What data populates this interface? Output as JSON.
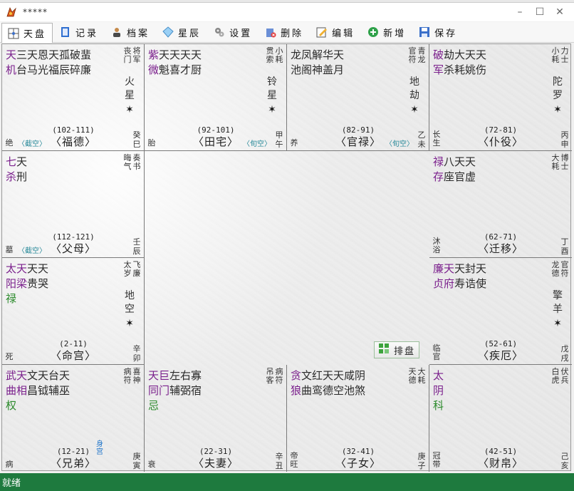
{
  "window": {
    "title": "*****"
  },
  "toolbar": [
    {
      "label": "天盘",
      "icon": "grid-icon"
    },
    {
      "label": "记录",
      "icon": "notebook-icon"
    },
    {
      "label": "档案",
      "icon": "person-icon"
    },
    {
      "label": "星辰",
      "icon": "diamond-icon"
    },
    {
      "label": "设置",
      "icon": "gears-icon"
    },
    {
      "label": "删除",
      "icon": "delete-icon"
    },
    {
      "label": "编辑",
      "icon": "edit-icon"
    },
    {
      "label": "新增",
      "icon": "plus-icon"
    },
    {
      "label": "保存",
      "icon": "save-icon"
    }
  ],
  "palaces": [
    {
      "name": "福德",
      "ages": "(102-111)",
      "stage": "绝",
      "ganzhi": "癸巳",
      "row1": [
        [
          "天",
          "purple"
        ],
        [
          "三天恩天孤破蜚",
          "dark"
        ]
      ],
      "row2": [
        [
          "机",
          "purple"
        ],
        [
          "台马光福辰碎廉",
          "dark"
        ]
      ],
      "row3": [],
      "corner": [
        "将军",
        "丧门"
      ],
      "vstar": "火星",
      "kong": "〈截空〉"
    },
    {
      "name": "田宅",
      "ages": "(92-101)",
      "stage": "胎",
      "ganzhi": "甲午",
      "row1": [
        [
          "紫",
          "purple"
        ],
        [
          "天天天天",
          "dark"
        ]
      ],
      "row2": [
        [
          "微",
          "purple"
        ],
        [
          "魁喜才厨",
          "dark"
        ]
      ],
      "row3": [],
      "corner": [
        "小耗",
        "贯索"
      ],
      "vstar": "铃星",
      "kong": "〈旬空〉"
    },
    {
      "name": "官禄",
      "ages": "(82-91)",
      "stage": "养",
      "ganzhi": "乙未",
      "row1": [
        [
          "龙凤解华天",
          "dark"
        ]
      ],
      "row2": [
        [
          "池阁神盖月",
          "dark"
        ]
      ],
      "row3": [],
      "corner": [
        "青龙",
        "官符"
      ],
      "vstar": "地劫",
      "kong": "〈旬空〉"
    },
    {
      "name": "仆役",
      "ages": "(72-81)",
      "stage": "长生",
      "ganzhi": "丙申",
      "row1": [
        [
          "破",
          "purple"
        ],
        [
          "劫大天天",
          "dark"
        ]
      ],
      "row2": [
        [
          "军",
          "purple"
        ],
        [
          "杀耗姚伤",
          "dark"
        ]
      ],
      "row3": [],
      "corner": [
        "力士",
        "小耗"
      ],
      "vstar": "陀罗",
      "kong": ""
    },
    {
      "name": "父母",
      "ages": "(112-121)",
      "stage": "墓",
      "ganzhi": "壬辰",
      "row1": [
        [
          "七",
          "purple"
        ],
        [
          "天",
          "dark"
        ]
      ],
      "row2": [
        [
          "杀",
          "purple"
        ],
        [
          "刑",
          "dark"
        ]
      ],
      "row3": [],
      "corner": [
        "奏书",
        "晦气"
      ],
      "vstar": "",
      "kong": "〈截空〉"
    },
    {
      "name": "迁移",
      "ages": "(62-71)",
      "stage": "沐浴",
      "ganzhi": "丁酉",
      "row1": [
        [
          "禄",
          "purple"
        ],
        [
          "八天天",
          "dark"
        ]
      ],
      "row2": [
        [
          "存",
          "purple"
        ],
        [
          "座官虚",
          "dark"
        ]
      ],
      "row3": [],
      "corner": [
        "博士",
        "大耗"
      ],
      "vstar": "",
      "kong": ""
    },
    {
      "name": "命宫",
      "ages": "(2-11)",
      "stage": "死",
      "ganzhi": "辛卯",
      "row1": [
        [
          "太天",
          "purple"
        ],
        [
          "天天",
          "dark"
        ]
      ],
      "row2": [
        [
          "阳梁",
          "purple"
        ],
        [
          "贵哭",
          "dark"
        ]
      ],
      "row3": [
        [
          "禄",
          "green"
        ]
      ],
      "corner": [
        "飞廉",
        "太岁"
      ],
      "vstar": "地空",
      "kong": ""
    },
    {
      "name": "疾厄",
      "ages": "(52-61)",
      "stage": "临官",
      "ganzhi": "戊戌",
      "row1": [
        [
          "廉天",
          "purple"
        ],
        [
          "天封天",
          "dark"
        ]
      ],
      "row2": [
        [
          "贞府",
          "purple"
        ],
        [
          "寿诰使",
          "dark"
        ]
      ],
      "row3": [],
      "corner": [
        "官符",
        "龙德"
      ],
      "vstar": "擎羊",
      "kong": ""
    },
    {
      "name": "兄弟",
      "ages": "(12-21)",
      "stage": "病",
      "ganzhi": "庚寅",
      "row1": [
        [
          "武天",
          "purple"
        ],
        [
          "文天台天",
          "dark"
        ]
      ],
      "row2": [
        [
          "曲相",
          "purple"
        ],
        [
          "昌钺辅巫",
          "dark"
        ]
      ],
      "row3": [
        [
          "权",
          "green"
        ]
      ],
      "corner": [
        "喜神",
        "病符"
      ],
      "vstar": "",
      "kong": "",
      "shen": "身宫"
    },
    {
      "name": "夫妻",
      "ages": "(22-31)",
      "stage": "衰",
      "ganzhi": "辛丑",
      "row1": [
        [
          "天巨",
          "purple"
        ],
        [
          "左右寡",
          "dark"
        ]
      ],
      "row2": [
        [
          "同门",
          "purple"
        ],
        [
          "辅弼宿",
          "dark"
        ]
      ],
      "row3": [
        [
          "忌",
          "green"
        ]
      ],
      "corner": [
        "病符",
        "吊客"
      ],
      "vstar": "",
      "kong": ""
    },
    {
      "name": "子女",
      "ages": "(32-41)",
      "stage": "帝旺",
      "ganzhi": "庚子",
      "row1": [
        [
          "贪",
          "purple"
        ],
        [
          "文红天天咸阴",
          "dark"
        ]
      ],
      "row2": [
        [
          "狼",
          "purple"
        ],
        [
          "曲鸾德空池煞",
          "dark"
        ]
      ],
      "row3": [],
      "corner": [
        "大耗",
        "天德"
      ],
      "vstar": "",
      "kong": ""
    },
    {
      "name": "财帛",
      "ages": "(42-51)",
      "stage": "冠带",
      "ganzhi": "己亥",
      "row1": [
        [
          "太",
          "purple"
        ]
      ],
      "row2": [
        [
          "阴",
          "purple"
        ]
      ],
      "row3": [
        [
          "科",
          "green"
        ]
      ],
      "corner": [
        "伏兵",
        "白虎"
      ],
      "vstar": "",
      "kong": ""
    }
  ],
  "center": {
    "button_label": "排盘",
    "button_icon": "chart-icon"
  },
  "status": {
    "text": "就绪"
  }
}
